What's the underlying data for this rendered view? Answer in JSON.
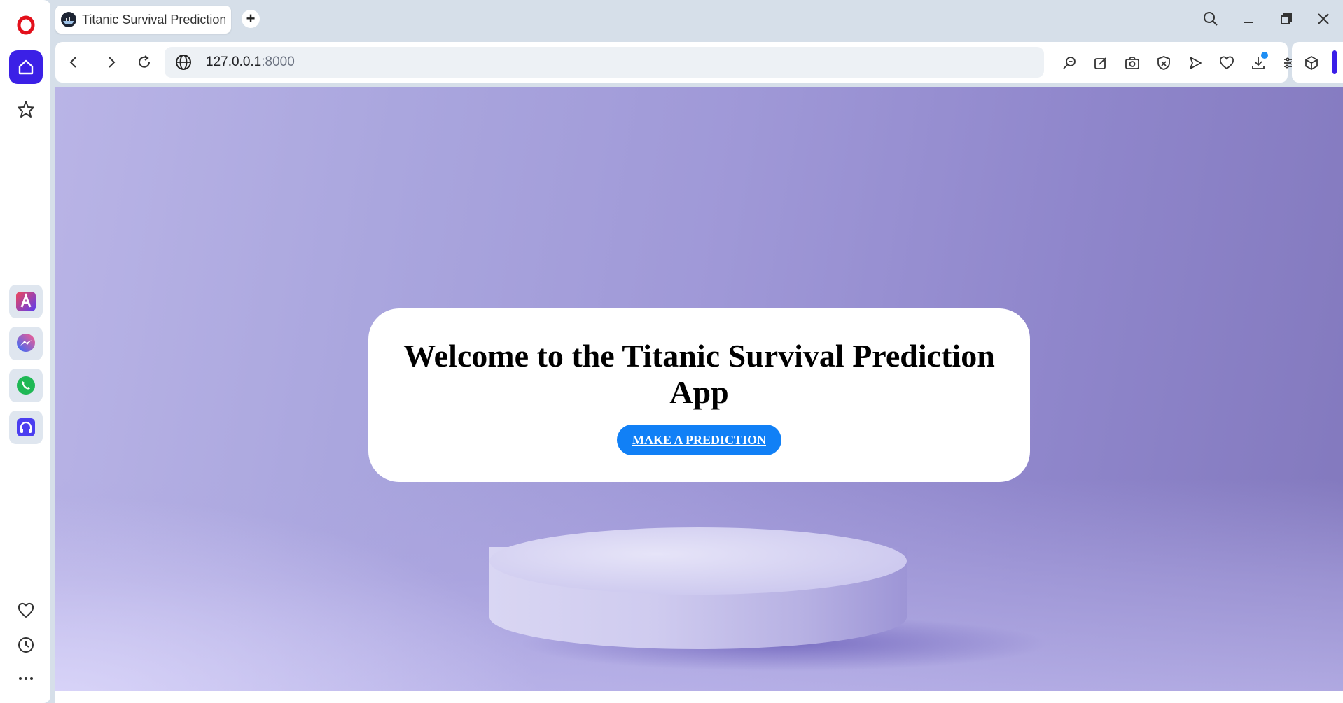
{
  "browser": {
    "tab": {
      "title": "Titanic Survival Prediction",
      "favicon": "titanic-ship-icon"
    },
    "new_tab_label": "+",
    "address": {
      "host": "127.0.0.1",
      "port": ":8000"
    },
    "accent_color": "#3a1ee8"
  },
  "sidebar": {
    "top": [
      "opera-logo-icon",
      "home-icon",
      "star-icon"
    ],
    "apps": [
      "aria-icon",
      "messenger-icon",
      "whatsapp-icon",
      "music-player-icon"
    ],
    "bottom": [
      "heart-icon",
      "history-icon",
      "more-icon"
    ]
  },
  "toolbar": {
    "icons": [
      "zoom-icon",
      "edit-icon",
      "snapshot-icon",
      "adblock-icon",
      "send-icon",
      "heart-icon",
      "download-icon",
      "easy-setup-icon",
      "profile-icon"
    ]
  },
  "page": {
    "heading": "Welcome to the Titanic Survival Prediction App",
    "cta_label": "MAKE A PREDICTION",
    "cta_color": "#1180f6"
  }
}
